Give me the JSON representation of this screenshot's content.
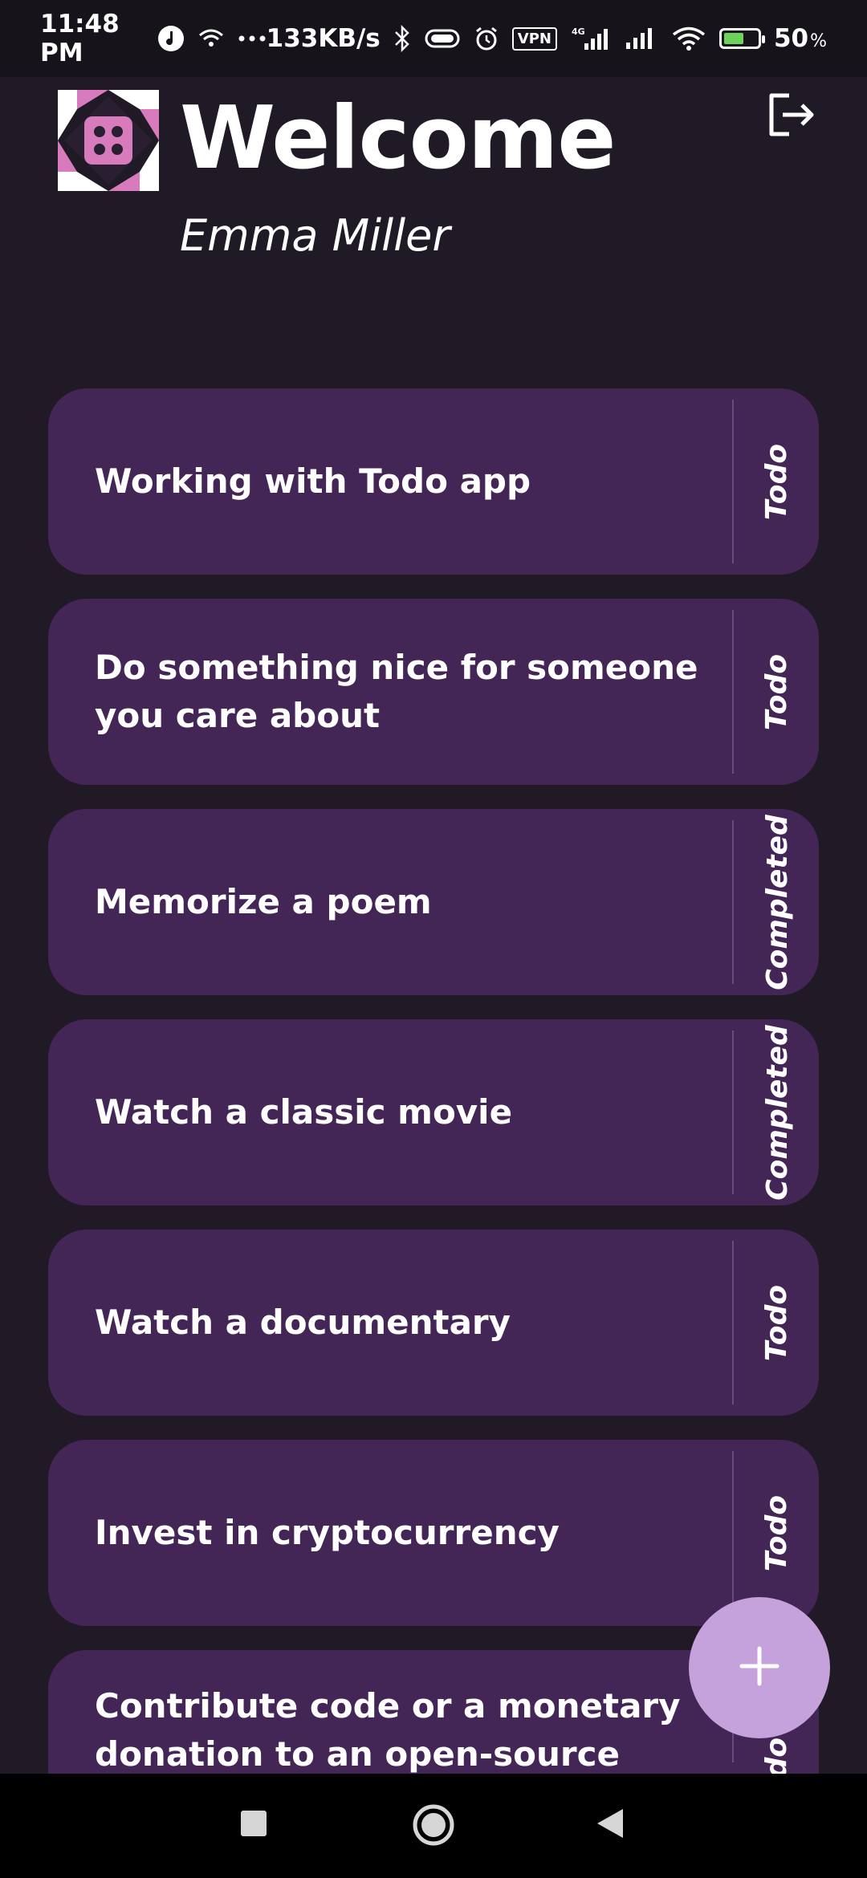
{
  "status_bar": {
    "time": "11:48 PM",
    "speed": "133KB/s",
    "vpn": "VPN",
    "network": "4G",
    "battery_pct": "50",
    "battery_unit": "%"
  },
  "header": {
    "title": "Welcome",
    "user_name": "Emma Miller"
  },
  "todos": [
    {
      "text": "Working with Todo app",
      "status": "Todo"
    },
    {
      "text": "Do something nice for someone you care about",
      "status": "Todo"
    },
    {
      "text": "Memorize a poem",
      "status": "Completed"
    },
    {
      "text": "Watch a classic movie",
      "status": "Completed"
    },
    {
      "text": "Watch a documentary",
      "status": "Todo"
    },
    {
      "text": "Invest in cryptocurrency",
      "status": "Todo"
    },
    {
      "text": "Contribute code or a monetary donation to an open-source softwa",
      "status": "Todo"
    }
  ],
  "colors": {
    "background": "#201a26",
    "card": "#432556",
    "fab": "#c5a2db",
    "logo_pink": "#d87bbd"
  },
  "icons": {
    "logout": "logout-icon",
    "add": "plus-icon",
    "nav_recents": "square-icon",
    "nav_home": "circle-icon",
    "nav_back": "triangle-back-icon"
  }
}
